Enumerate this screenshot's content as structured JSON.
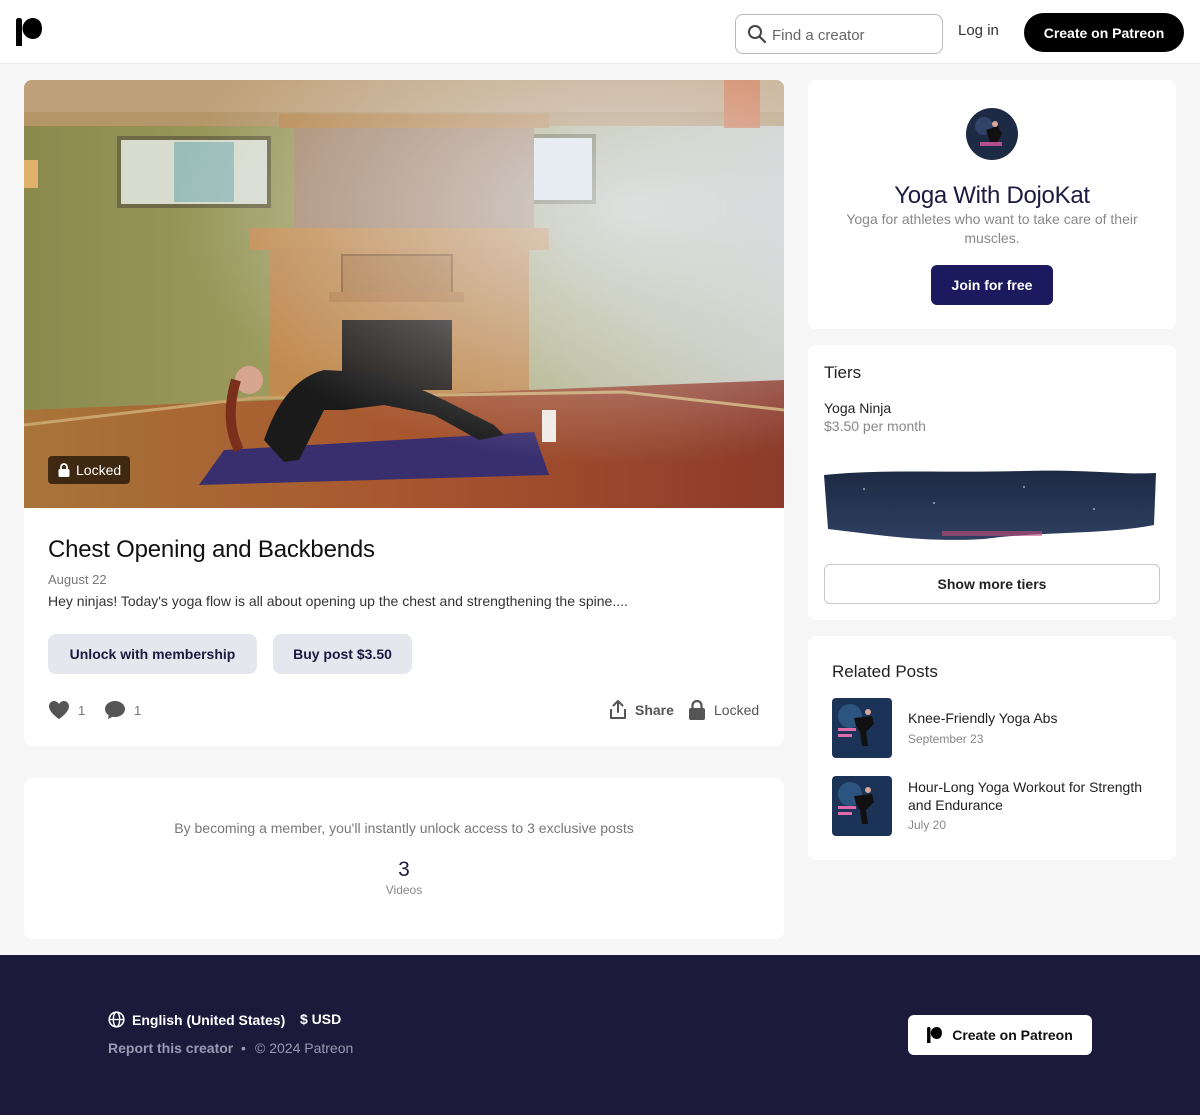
{
  "header": {
    "search_placeholder": "Find a creator",
    "login_label": "Log in",
    "create_label": "Create on Patreon"
  },
  "post": {
    "locked_chip": "Locked",
    "title": "Chest Opening and Backbends",
    "date": "August 22",
    "excerpt": "Hey ninjas! Today's yoga flow is all about opening up the chest and strengthening the spine....",
    "unlock_label": "Unlock with membership",
    "buy_label": "Buy post $3.50",
    "likes": "1",
    "comments": "1",
    "share_label": "Share",
    "locked_label": "Locked"
  },
  "member": {
    "text": "By becoming a member, you'll instantly unlock access to 3 exclusive posts",
    "count": "3",
    "count_label": "Videos"
  },
  "creator": {
    "name": "Yoga With DojoKat",
    "description": "Yoga for athletes who want to take care of their muscles.",
    "join_label": "Join for free"
  },
  "tiers": {
    "title": "Tiers",
    "items": [
      {
        "name": "Yoga Ninja",
        "price": "$3.50 per month"
      }
    ],
    "more_label": "Show more tiers"
  },
  "related": {
    "title": "Related Posts",
    "items": [
      {
        "name": "Knee-Friendly Yoga Abs",
        "date": "September 23"
      },
      {
        "name": "Hour-Long Yoga Workout for Strength and Endurance",
        "date": "July 20"
      }
    ]
  },
  "footer": {
    "language": "English (United States)",
    "currency": "$ USD",
    "report_label": "Report this creator",
    "separator": "•",
    "copyright": "© 2024 Patreon",
    "create_label": "Create on Patreon"
  },
  "colors": {
    "brand_dark": "#1b1a3b",
    "join_button": "#1b1a5f",
    "secondary_button": "#e6e6ee"
  }
}
